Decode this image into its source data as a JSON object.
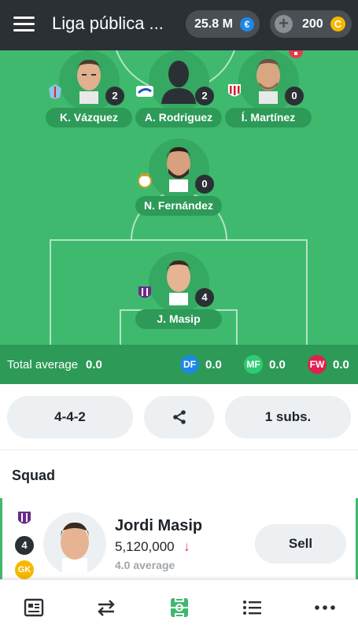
{
  "header": {
    "title": "Liga pública ...",
    "money": "25.8 M",
    "money_icon": "€",
    "coins": "200",
    "coin_icon": "C",
    "plus_icon": "+"
  },
  "colors": {
    "pitch": "#3fb96e",
    "pitch_dark": "#2d9a58",
    "topbar": "#2b3035",
    "df": "#1e88e5",
    "mf": "#2ecc71",
    "fw": "#e0204f",
    "gk": "#f5b800"
  },
  "players": [
    {
      "name": "K. Vázquez",
      "points": "2",
      "badge_icon": "celta-crest-icon"
    },
    {
      "name": "A. Rodriguez",
      "points": "2",
      "badge_icon": "alaves-crest-icon"
    },
    {
      "name": "Í. Martínez",
      "points": "0",
      "badge_icon": "athletic-crest-icon"
    },
    {
      "name": "N. Fernández",
      "points": "0",
      "badge_icon": "real-madrid-crest-icon"
    },
    {
      "name": "J. Masip",
      "points": "4",
      "badge_icon": "valladolid-crest-icon"
    }
  ],
  "average": {
    "label": "Total average",
    "total": "0.0",
    "df_label": "DF",
    "df": "0.0",
    "mf_label": "MF",
    "mf": "0.0",
    "fw_label": "FW",
    "fw": "0.0"
  },
  "controls": {
    "formation": "4-4-2",
    "share_icon": "share-icon",
    "subs": "1 subs."
  },
  "squad": {
    "title": "Squad",
    "player": {
      "name": "Jordi Masip",
      "price": "5,120,000",
      "trend_arrow": "↓",
      "average": "4.0 average",
      "points": "4",
      "position": "GK",
      "club_icon": "valladolid-crest-icon"
    },
    "sell_label": "Sell"
  },
  "bottom_nav": [
    "news-icon",
    "market-icon",
    "lineup-icon",
    "standings-icon",
    "more-icon"
  ]
}
